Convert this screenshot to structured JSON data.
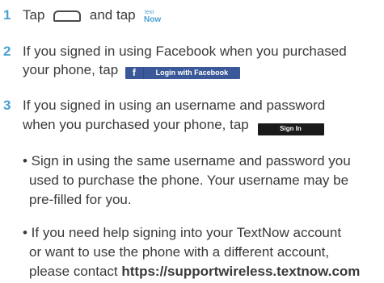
{
  "steps": [
    {
      "number": "1",
      "part1": "Tap",
      "part2": "and tap"
    },
    {
      "number": "2",
      "line1": "If you signed in using Facebook when you purchased",
      "line2": "your phone, tap"
    },
    {
      "number": "3",
      "line1": "If you signed in using an username and password",
      "line2": "when you purchased your phone, tap"
    }
  ],
  "buttons": {
    "facebook_icon": "f",
    "facebook_label": "Login with Facebook",
    "signin_label": "Sign In"
  },
  "logo_text": "TextNow",
  "bullets": [
    {
      "lines": [
        "• Sign in using the same username and password you",
        "  used to purchase the phone. Your username may be",
        "  pre-filled for you."
      ]
    },
    {
      "lines": [
        "• If you need help signing into your TextNow account",
        "  or want to use the phone with a different account,",
        "  please contact"
      ],
      "link": "https://supportwireless.textnow.com"
    }
  ],
  "colors": {
    "accent": "#4a9fd3",
    "text": "#3a3a3a",
    "facebook": "#3b5998",
    "signin": "#1a1a1a"
  }
}
